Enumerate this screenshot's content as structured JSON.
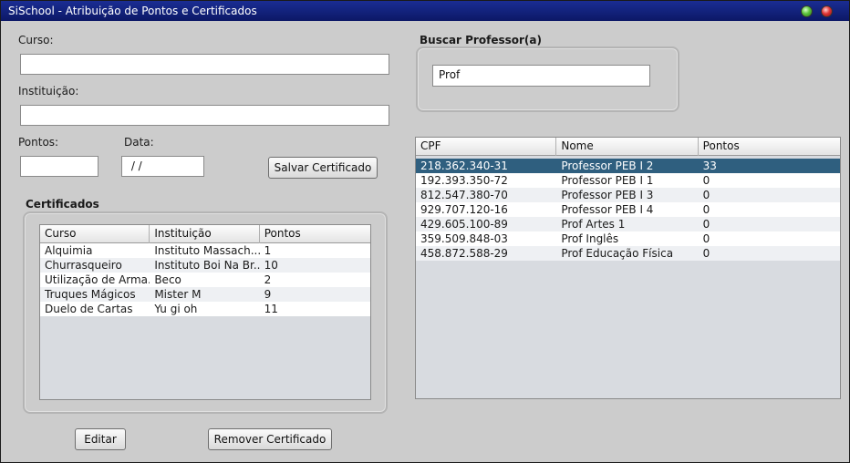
{
  "window": {
    "title": "SiSchool - Atribuição de Pontos e Certificados"
  },
  "form": {
    "curso_label": "Curso:",
    "curso_value": "",
    "instituicao_label": "Instituição:",
    "instituicao_value": "",
    "pontos_label": "Pontos:",
    "pontos_value": "",
    "data_label": "Data:",
    "data_value": " / /",
    "save_button": "Salvar Certificado"
  },
  "certificados": {
    "title": "Certificados",
    "columns": [
      "Curso",
      "Instituição",
      "Pontos"
    ],
    "rows": [
      [
        "Alquimia",
        "Instituto Massach...",
        "1"
      ],
      [
        "Churrasqueiro",
        "Instituto Boi Na Br...",
        "10"
      ],
      [
        "Utilização de Arma...",
        "Beco",
        "2"
      ],
      [
        "Truques Mágicos",
        "Mister M",
        "9"
      ],
      [
        "Duelo de Cartas",
        "Yu gi oh",
        "11"
      ]
    ],
    "edit_button": "Editar",
    "remove_button": "Remover Certificado"
  },
  "busca": {
    "title": "Buscar Professor(a)",
    "value": "Prof"
  },
  "professores": {
    "columns": [
      "CPF",
      "Nome",
      "Pontos"
    ],
    "selected_index": 0,
    "rows": [
      [
        "218.362.340-31",
        "Professor PEB I 2",
        "33"
      ],
      [
        "192.393.350-72",
        "Professor PEB I 1",
        "0"
      ],
      [
        "812.547.380-70",
        "Professor PEB I 3",
        "0"
      ],
      [
        "929.707.120-16",
        "Professor PEB I 4",
        "0"
      ],
      [
        "429.605.100-89",
        "Prof Artes 1",
        "0"
      ],
      [
        "359.509.848-03",
        "Prof Inglês",
        "0"
      ],
      [
        "458.872.588-29",
        "Prof Educação Física",
        "0"
      ]
    ]
  },
  "colors": {
    "titlebar": "#0f1f7a",
    "selection": "#2f5f7f",
    "background": "#cccccc"
  }
}
